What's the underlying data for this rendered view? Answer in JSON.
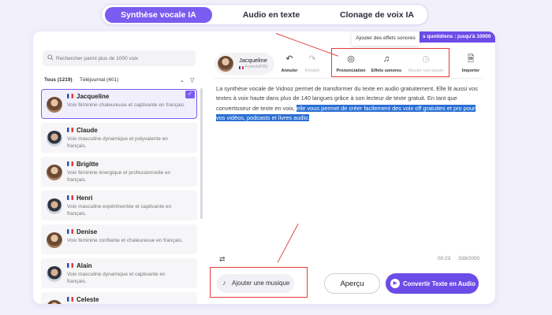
{
  "tabs": [
    {
      "label": "Synthèse vocale IA"
    },
    {
      "label": "Audio en texte"
    },
    {
      "label": "Clonage de voix IA"
    }
  ],
  "promo": "s quotidiens : jusqu'à 10000",
  "tooltip": "Ajouter des effets sonores",
  "search": {
    "placeholder": "Rechercher parmi plus de 1000 voix"
  },
  "filters": {
    "all": "Tous (1219)",
    "telejournal": "Téléjournal (401)"
  },
  "voices": [
    {
      "name": "Jacqueline",
      "desc": "Voix féminine chaleureuse et captivante en français."
    },
    {
      "name": "Claude",
      "desc": "Voix masculine dynamique et polyvalente en français."
    },
    {
      "name": "Brigitte",
      "desc": "Voix féminine énergique et professionnelle en français."
    },
    {
      "name": "Henri",
      "desc": "Voix masculine expérimentée et captivante en français."
    },
    {
      "name": "Denise",
      "desc": "Voix féminine confiante et chaleureuse en français."
    },
    {
      "name": "Alain",
      "desc": "Voix masculine dynamique et captivante en français."
    },
    {
      "name": "Celeste",
      "desc": ""
    }
  ],
  "selected_voice": {
    "name": "Jacqueline",
    "lang": "French(FR)"
  },
  "toolbar": {
    "undo": "Annuler",
    "redo": "Rétablir",
    "pronunciation": "Prononciation",
    "sound_effects": "Effets sonores",
    "pause": "Ajouter une pause",
    "import": "Importer"
  },
  "editor": {
    "text_plain": "La synthèse vocale de Vidnoz permet de transformer du texte en audio gratuitement. Elle lit aussi vos textes à voix haute dans plus de 140 langues grâce à son lecteur de texte gratuit. En tant que convertisseur de texte en voix, ",
    "text_selected": "elle vous permet de créer facilement des voix off gratuites et pro pour vos vidéos, podcasts et livres audio."
  },
  "status": {
    "time": "00:23",
    "count": "338/2000"
  },
  "actions": {
    "add_music": "Ajouter une musique",
    "preview": "Aperçu",
    "convert": "Convertir Texte en Audio"
  },
  "colors": {
    "accent": "#7b5cf0",
    "selection": "#2a6fd4",
    "annotation": "#e63b3b"
  }
}
